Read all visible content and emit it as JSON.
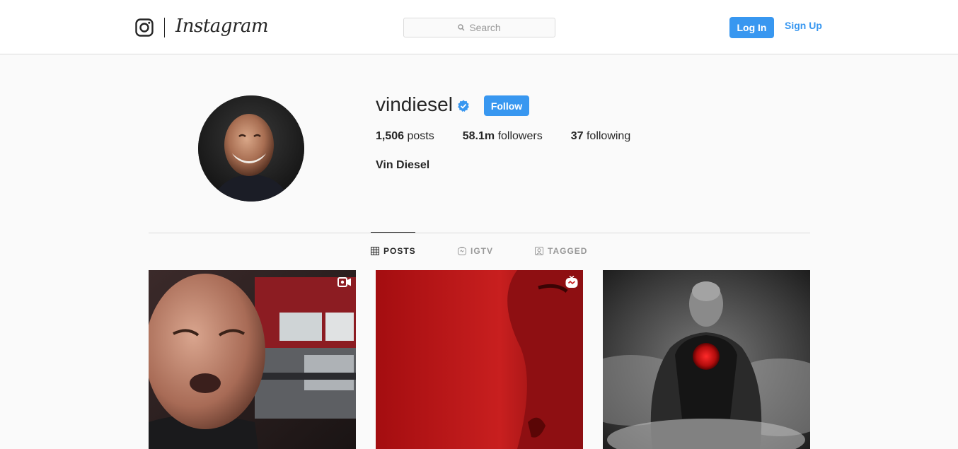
{
  "header": {
    "brand": "Instagram",
    "search_placeholder": "Search",
    "login_label": "Log In",
    "signup_label": "Sign Up"
  },
  "profile": {
    "username": "vindiesel",
    "verified": true,
    "follow_label": "Follow",
    "posts_count": "1,506",
    "posts_label": "posts",
    "followers_count": "58.1m",
    "followers_label": "followers",
    "following_count": "37",
    "following_label": "following",
    "full_name": "Vin Diesel"
  },
  "tabs": [
    {
      "label": "POSTS",
      "icon": "grid-icon",
      "active": true
    },
    {
      "label": "IGTV",
      "icon": "igtv-icon",
      "active": false
    },
    {
      "label": "TAGGED",
      "icon": "tagged-icon",
      "active": false
    }
  ],
  "posts": [
    {
      "type": "video",
      "icon": "video-icon"
    },
    {
      "type": "igtv",
      "icon": "igtv-icon"
    },
    {
      "type": "photo",
      "icon": ""
    }
  ],
  "colors": {
    "accent": "#3897f0",
    "text": "#262626",
    "border": "#dbdbdb",
    "background": "#fafafa"
  }
}
